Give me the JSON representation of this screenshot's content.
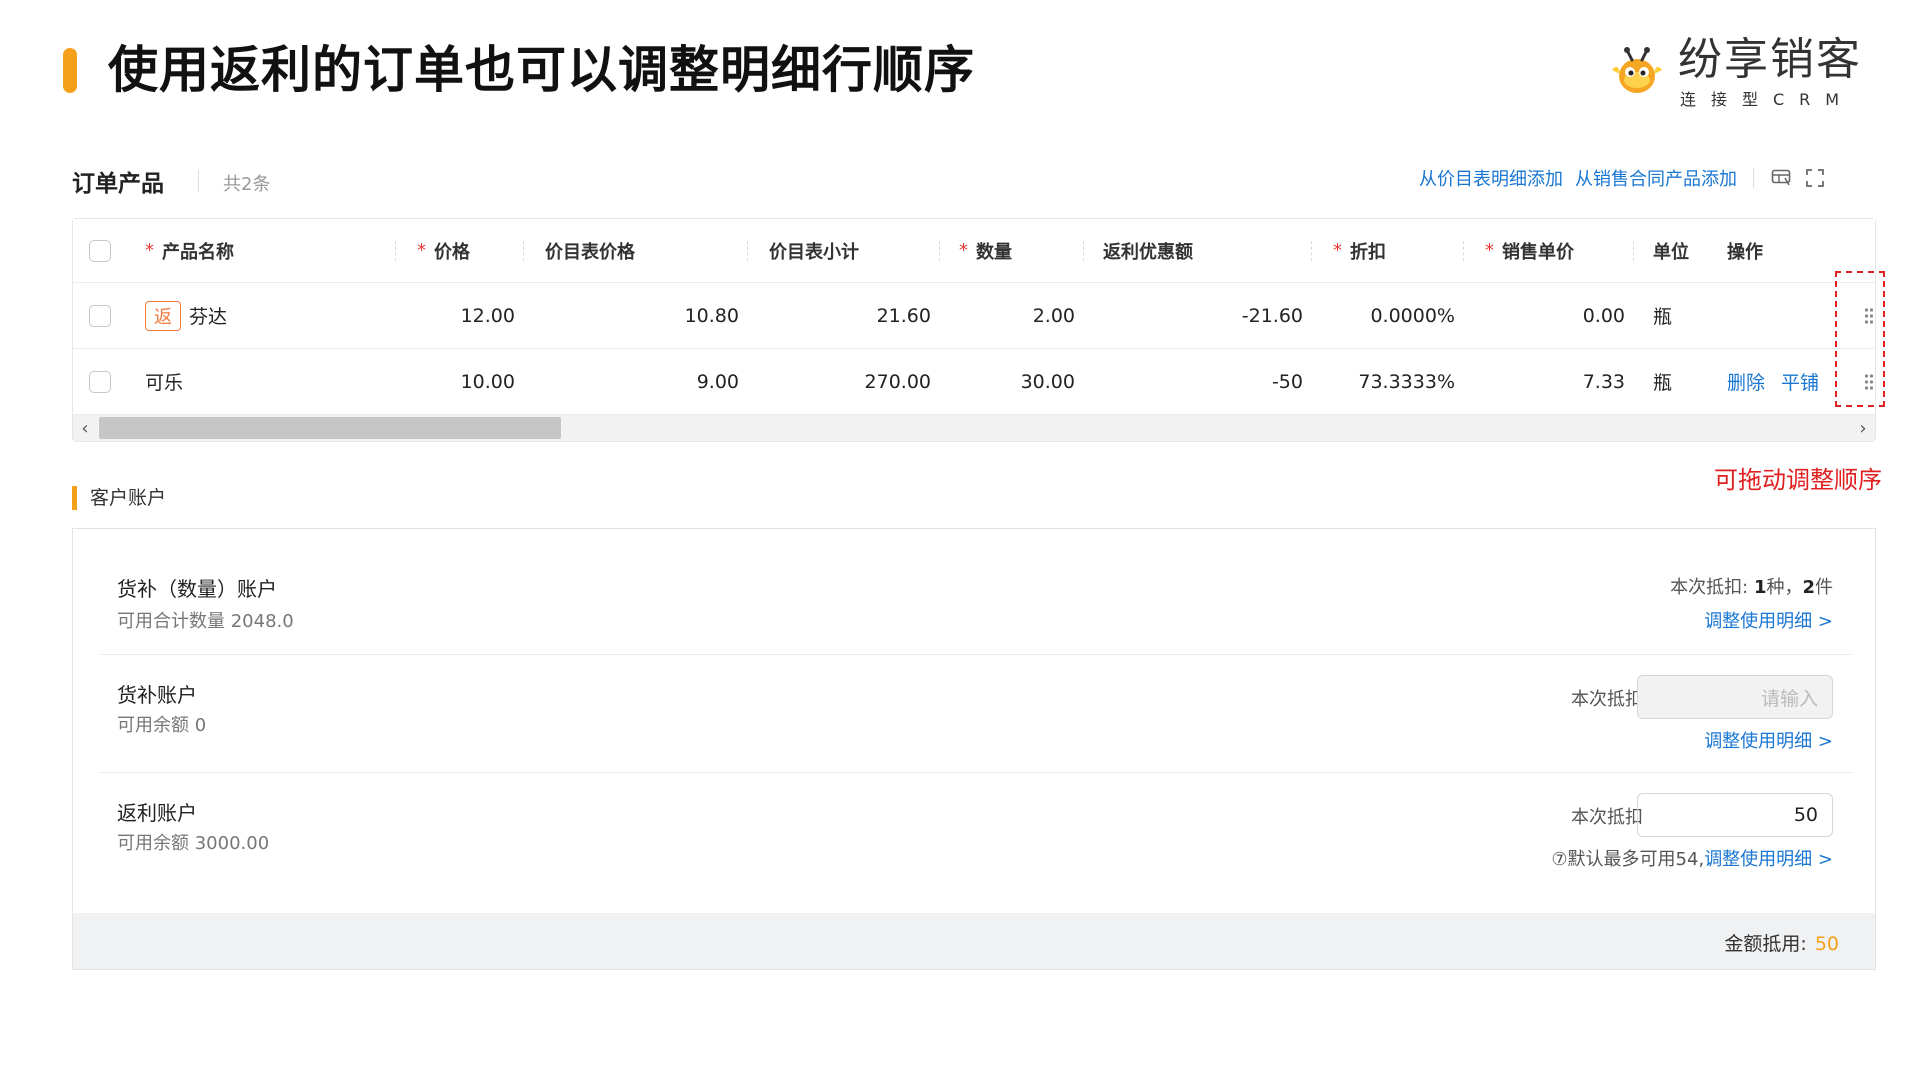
{
  "slide": {
    "title": "使用返利的订单也可以调整明细行顺序"
  },
  "logo": {
    "main": "纷享销客",
    "sub": "连接型CRM"
  },
  "order_products": {
    "title": "订单产品",
    "count": "共2条",
    "link_price_list": "从价目表明细添加",
    "link_contract": "从销售合同产品添加",
    "columns": [
      "产品名称",
      "价格",
      "价目表价格",
      "价目表小计",
      "数量",
      "返利优惠额",
      "折扣",
      "销售单价",
      "单位",
      "操作"
    ],
    "rows": [
      {
        "tag": "返",
        "name": "芬达",
        "price": "12.00",
        "list_price": "10.80",
        "list_subtotal": "21.60",
        "quantity": "2.00",
        "rebate": "-21.60",
        "discount": "0.0000%",
        "unit_price": "0.00",
        "unit": "瓶",
        "actions": []
      },
      {
        "tag": "",
        "name": "可乐",
        "price": "10.00",
        "list_price": "9.00",
        "list_subtotal": "270.00",
        "quantity": "30.00",
        "rebate": "-50",
        "discount": "73.3333%",
        "unit_price": "7.33",
        "unit": "瓶",
        "actions": [
          "删除",
          "平铺"
        ]
      }
    ],
    "scroll_position": 0.0
  },
  "annotation": "可拖动调整顺序",
  "customer_account": {
    "title": "客户账户",
    "accounts": [
      {
        "name": "货补（数量）账户",
        "sub": "可用合计数量 2048.0",
        "deduct_prefix": "本次抵扣: ",
        "deduct_kinds": "1",
        "deduct_kinds_unit": "种，",
        "deduct_items": "2",
        "deduct_items_unit": "件",
        "link": "调整使用明细 >"
      },
      {
        "name": "货补账户",
        "sub": "可用余额 0",
        "deduct_label": "本次抵扣",
        "input_placeholder": "请输入",
        "link": "调整使用明细 >"
      },
      {
        "name": "返利账户",
        "sub": "可用余额 3000.00",
        "deduct_label": "本次抵扣",
        "input_value": "50",
        "hint": "⑦默认最多可用54,",
        "link": "调整使用明细 >"
      }
    ],
    "footer_label": "金额抵用:",
    "footer_value": "50"
  },
  "colors": {
    "accent": "#f5a01a",
    "link": "#1976d2",
    "annotation": "#e02020",
    "rebate_tag": "#f07a3e"
  }
}
